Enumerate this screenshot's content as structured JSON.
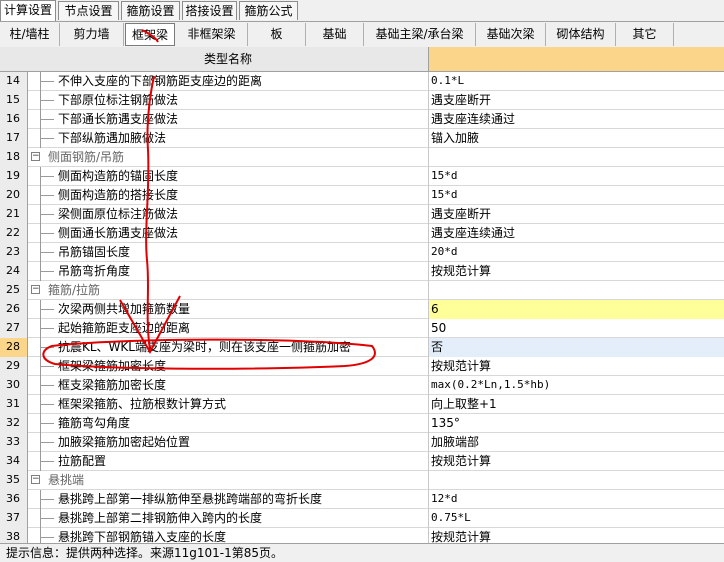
{
  "top_tabs": [
    "计算设置",
    "节点设置",
    "箍筋设置",
    "搭接设置",
    "箍筋公式"
  ],
  "sub_tabs": [
    "柱/墙柱",
    "剪力墙",
    "框架梁",
    "非框架梁",
    "板",
    "基础",
    "基础主梁/承台梁",
    "基础次梁",
    "砌体结构",
    "其它"
  ],
  "header": {
    "name": "类型名称",
    "value": ""
  },
  "rows": [
    {
      "num": "14",
      "name": "不伸入支座的下部钢筋距支座边的距离",
      "value": "0.1*L"
    },
    {
      "num": "15",
      "name": "下部原位标注钢筋做法",
      "value": "遇支座断开"
    },
    {
      "num": "16",
      "name": "下部通长筋遇支座做法",
      "value": "遇支座连续通过"
    },
    {
      "num": "17",
      "name": "下部纵筋遇加腋做法",
      "value": "锚入加腋"
    },
    {
      "num": "18",
      "name": "侧面钢筋/吊筋",
      "value": "",
      "group": true
    },
    {
      "num": "19",
      "name": "侧面构造筋的锚固长度",
      "value": "15*d"
    },
    {
      "num": "20",
      "name": "侧面构造筋的搭接长度",
      "value": "15*d"
    },
    {
      "num": "21",
      "name": "梁侧面原位标注筋做法",
      "value": "遇支座断开"
    },
    {
      "num": "22",
      "name": "侧面通长筋遇支座做法",
      "value": "遇支座连续通过"
    },
    {
      "num": "23",
      "name": "吊筋锚固长度",
      "value": "20*d"
    },
    {
      "num": "24",
      "name": "吊筋弯折角度",
      "value": "按规范计算"
    },
    {
      "num": "25",
      "name": "箍筋/拉筋",
      "value": "",
      "group": true
    },
    {
      "num": "26",
      "name": "次梁两侧共增加箍筋数量",
      "value": "6",
      "highlight": "yellow"
    },
    {
      "num": "27",
      "name": "起始箍筋距支座边的距离",
      "value": "50"
    },
    {
      "num": "28",
      "name": "抗震KL、WKL端支座为梁时，则在该支座一侧箍筋加密",
      "value": "否",
      "selected": true
    },
    {
      "num": "29",
      "name": "框架梁箍筋加密长度",
      "value": "按规范计算"
    },
    {
      "num": "30",
      "name": "框支梁箍筋加密长度",
      "value": "max(0.2*Ln,1.5*hb)"
    },
    {
      "num": "31",
      "name": "框架梁箍筋、拉筋根数计算方式",
      "value": "向上取整+1"
    },
    {
      "num": "32",
      "name": "箍筋弯勾角度",
      "value": "135°"
    },
    {
      "num": "33",
      "name": "加腋梁箍筋加密起始位置",
      "value": "加腋端部"
    },
    {
      "num": "34",
      "name": "拉筋配置",
      "value": "按规范计算"
    },
    {
      "num": "35",
      "name": "悬挑端",
      "value": "",
      "group": true
    },
    {
      "num": "36",
      "name": "悬挑跨上部第一排纵筋伸至悬挑跨端部的弯折长度",
      "value": "12*d"
    },
    {
      "num": "37",
      "name": "悬挑跨上部第二排钢筋伸入跨内的长度",
      "value": "0.75*L"
    },
    {
      "num": "38",
      "name": "悬挑跨下部钢筋锚入支座的长度",
      "value": "按规范计算"
    }
  ],
  "status": "提示信息：提供两种选择。来源11g101-1第85页。",
  "colors": {
    "header_value": "#fbd68a",
    "selected_value": "#e3eefa",
    "yellow_value": "#ffff99",
    "annotation": "#e00000"
  }
}
